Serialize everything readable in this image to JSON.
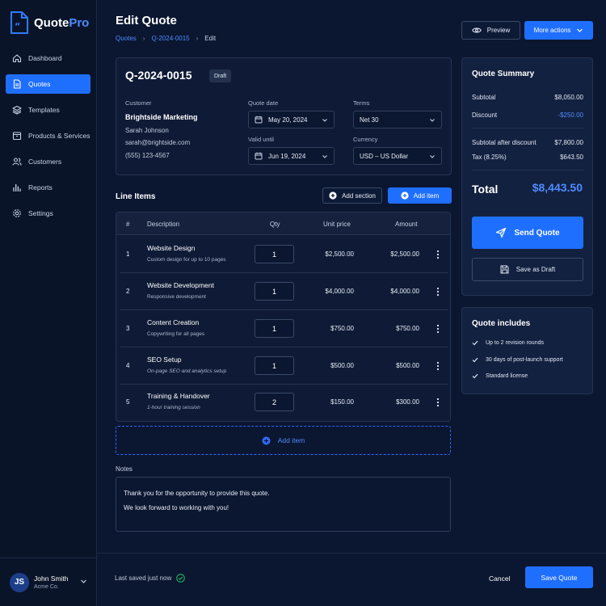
{
  "app": {
    "name_part1": "Quote",
    "name_part2": "Pro"
  },
  "sidebar": {
    "items": [
      {
        "label": "Dashboard",
        "icon": "home-icon"
      },
      {
        "label": "Quotes",
        "icon": "document-icon",
        "active": true
      },
      {
        "label": "Templates",
        "icon": "layers-icon"
      },
      {
        "label": "Products & Services",
        "icon": "box-icon"
      },
      {
        "label": "Customers",
        "icon": "users-icon"
      },
      {
        "label": "Reports",
        "icon": "bar-chart-icon"
      },
      {
        "label": "Settings",
        "icon": "gear-icon"
      }
    ],
    "user": {
      "initials": "JS",
      "name": "John Smith",
      "company": "Acme Co."
    }
  },
  "header": {
    "title": "Edit Quote",
    "breadcrumb": [
      "Quotes",
      "Q-2024-0015",
      "Edit"
    ],
    "preview_label": "Preview",
    "more_actions_label": "More actions"
  },
  "quote": {
    "number": "Q-2024-0015",
    "status": "Draft",
    "customer_label": "Customer",
    "customer": {
      "company": "Brightside Marketing",
      "contact": "Sarah Johnson",
      "email": "sarah@brightside.com",
      "phone": "(555) 123-4567"
    },
    "quote_date_label": "Quote date",
    "quote_date": "May 20, 2024",
    "valid_until_label": "Valid until",
    "valid_until": "Jun 19, 2024",
    "terms_label": "Terms",
    "terms": "Net 30",
    "currency_label": "Currency",
    "currency": "USD – US Dollar"
  },
  "line_items": {
    "title": "Line Items",
    "add_section_label": "Add section",
    "add_item_label": "Add item",
    "headers": {
      "num": "#",
      "description": "Description",
      "qty": "Qty",
      "unit_price": "Unit price",
      "amount": "Amount"
    },
    "rows": [
      {
        "num": "1",
        "title": "Website Design",
        "sub": "Custom design for up to 10 pages",
        "qty": "1",
        "unit_price": "$2,500.00",
        "amount": "$2,500.00"
      },
      {
        "num": "2",
        "title": "Website Development",
        "sub": "Responsive development",
        "qty": "1",
        "unit_price": "$4,000.00",
        "amount": "$4,000.00"
      },
      {
        "num": "3",
        "title": "Content Creation",
        "sub": "Copywriting for all pages",
        "qty": "1",
        "unit_price": "$750.00",
        "amount": "$750.00"
      },
      {
        "num": "4",
        "title": "SEO Setup",
        "sub": "On-page SEO and analytics setup",
        "qty": "1",
        "unit_price": "$500.00",
        "amount": "$500.00"
      },
      {
        "num": "5",
        "title": "Training & Handover",
        "sub": "1-hour training session",
        "qty": "2",
        "unit_price": "$150.00",
        "amount": "$300.00"
      }
    ],
    "add_row_label": "Add item"
  },
  "notes": {
    "label": "Notes",
    "line1": "Thank you for the opportunity to provide this quote.",
    "line2": "We look forward to working with you!"
  },
  "summary": {
    "title": "Quote Summary",
    "subtotal_label": "Subtotal",
    "subtotal": "$8,050.00",
    "discount_label": "Discount",
    "discount": "-$250.00",
    "after_discount_label": "Subtotal after discount",
    "after_discount": "$7,800.00",
    "tax_label": "Tax (8.25%)",
    "tax": "$643.50",
    "total_label": "Total",
    "total": "$8,443.50",
    "send_label": "Send Quote",
    "save_draft_label": "Save as Draft"
  },
  "includes": {
    "title": "Quote includes",
    "items": [
      "Up to 2 revision rounds",
      "30 days of post-launch support",
      "Standard license"
    ]
  },
  "footer": {
    "saved_status": "Last saved just now",
    "cancel_label": "Cancel",
    "save_label": "Save Quote"
  },
  "colors": {
    "accent": "#1f6fff",
    "background": "#0b1630",
    "success": "#22c55e"
  }
}
